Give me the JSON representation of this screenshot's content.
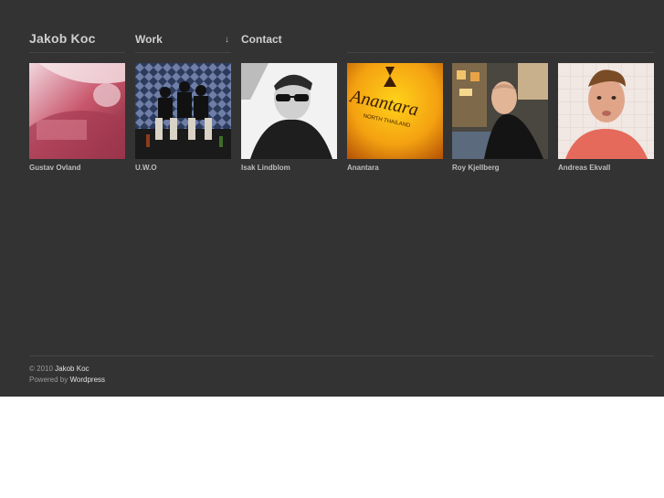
{
  "header": {
    "brand": "Jakob Koc"
  },
  "nav": {
    "work": "Work",
    "work_arrow": "↓",
    "contact": "Contact"
  },
  "portfolio": [
    {
      "caption": "Gustav Ovland"
    },
    {
      "caption": "U.W.O"
    },
    {
      "caption": "Isak Lindblom"
    },
    {
      "caption": "Anantara",
      "sign_text": "Anantara",
      "sign_subtext": "NORTH THAILAND"
    },
    {
      "caption": "Roy Kjellberg"
    },
    {
      "caption": "Andreas Ekvall"
    }
  ],
  "footer": {
    "copyright_prefix": "© 2010",
    "owner": "Jakob Koc",
    "powered_prefix": "Powered by",
    "platform": "Wordpress"
  },
  "colors": {
    "background": "#333333",
    "page": "#ffffff",
    "text": "#cfcfcf"
  }
}
